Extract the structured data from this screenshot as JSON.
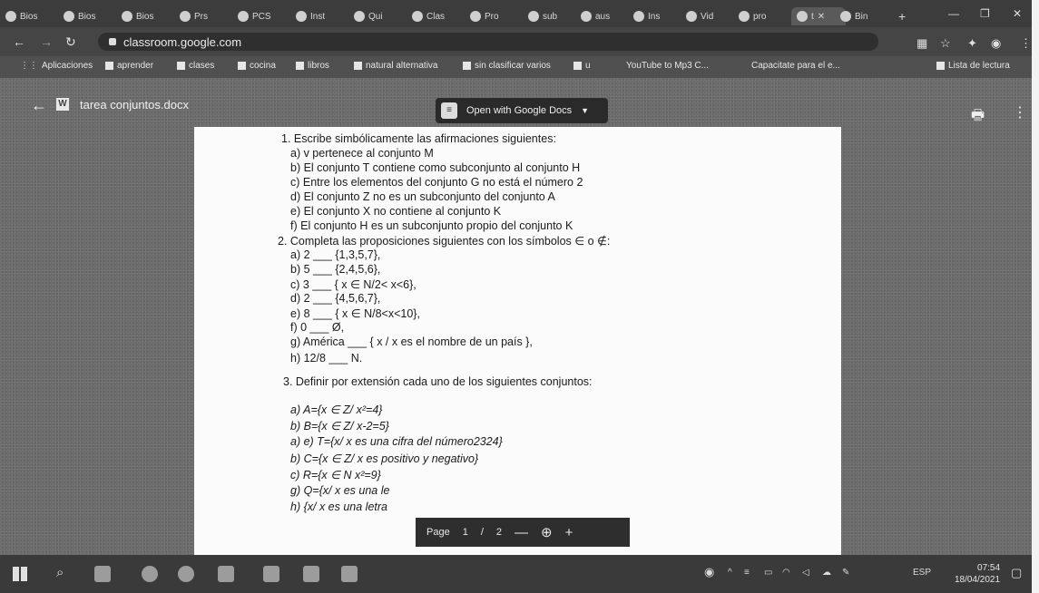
{
  "browser": {
    "tabs": [
      {
        "label": "Bios"
      },
      {
        "label": "Bios"
      },
      {
        "label": "Bios"
      },
      {
        "label": "Prs"
      },
      {
        "label": "PCS"
      },
      {
        "label": "Inst"
      },
      {
        "label": "Qui"
      },
      {
        "label": "Clas"
      },
      {
        "label": "Pro"
      },
      {
        "label": "sub"
      },
      {
        "label": "aus"
      },
      {
        "label": "Ins"
      },
      {
        "label": "Vid"
      },
      {
        "label": "pro"
      },
      {
        "label": "t"
      },
      {
        "label": "Bin"
      }
    ],
    "new_tab": "+",
    "url": "classroom.google.com",
    "bookmarks": [
      {
        "label": "Aplicaciones"
      },
      {
        "label": "aprender"
      },
      {
        "label": "clases"
      },
      {
        "label": "cocina"
      },
      {
        "label": "libros"
      },
      {
        "label": "natural alternativa"
      },
      {
        "label": "sin clasificar varios"
      },
      {
        "label": "u"
      },
      {
        "label": "YouTube to Mp3 C..."
      },
      {
        "label": "Capacitate para el e..."
      },
      {
        "label": "Lista de lectura"
      }
    ]
  },
  "viewer": {
    "filename": "tarea conjuntos.docx",
    "open_with": "Open with Google Docs",
    "doc_icon": "W",
    "gdocs_icon": "document-icon"
  },
  "document": {
    "lines": [
      "1.  Escribe simbólicamente las afirmaciones siguientes:",
      "a)  v pertenece al conjunto M",
      "b)  El conjunto T contiene como subconjunto al conjunto H",
      "c)  Entre los elementos del conjunto G no está el número 2",
      "d)  El conjunto Z no es un subconjunto del conjunto A",
      "e)  El conjunto X no contiene al conjunto K",
      "f)   El conjunto H es un subconjunto propio del conjunto K",
      "2.  Completa las proposiciones siguientes con los símbolos ∈ o ∉:",
      "a)  2 ___ {1,3,5,7},",
      "b)  5 ___ {2,4,5,6},",
      "c)  3 ___ { x ∈ N/2< x<6},",
      "d)  2 ___ {4,5,6,7},",
      "e)  8 ___ { x ∈ N/8<x<10},",
      "f)   0 ___ Ø,",
      "g)  América ___ { x / x es el nombre de un país },",
      "h)  12/8 ___ N.",
      "3. Definir por extensión cada uno de los siguientes conjuntos:",
      "a)  A={x ∈ Z/ x²=4}",
      "b)  B={x ∈ Z/ x-2=5}",
      "a)  e) T={x/ x es una cifra del número2324}",
      "b)  C={x ∈ Z/ x es positivo y negativo}",
      "c)  R={x ∈ N x²=9}",
      "g)  Q={x/ x es una le",
      "h)  {x/ x es una letra"
    ]
  },
  "pagenav": {
    "label": "Page",
    "current": "1",
    "sep": "/",
    "total": "2",
    "zoom_out": "—",
    "zoom_icon": "magnifier-icon",
    "zoom_in": "+"
  },
  "taskbar": {
    "language": "ESP",
    "time": "07:54",
    "date": "18/04/2021"
  }
}
